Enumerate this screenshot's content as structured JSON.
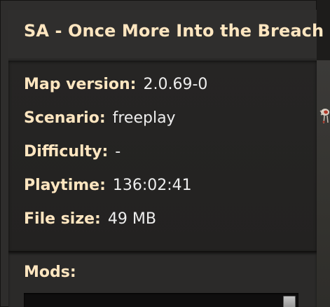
{
  "window": {
    "title": "SA - Once More Into the Breach"
  },
  "details": {
    "map_version_label": "Map version:",
    "map_version_value": "2.0.69-0",
    "scenario_label": "Scenario:",
    "scenario_value": "freeplay",
    "difficulty_label": "Difficulty:",
    "difficulty_value": "-",
    "playtime_label": "Playtime:",
    "playtime_value": "136:02:41",
    "file_size_label": "File size:",
    "file_size_value": "49 MB"
  },
  "mods": {
    "label": "Mods:"
  },
  "colors": {
    "heading": "#ffe6c0",
    "value": "#eeeeee",
    "panel": "#2f2e2d"
  },
  "icons": {
    "scrollbar": "scrollbar-thumb",
    "scene_creature": "biter-sprite"
  }
}
